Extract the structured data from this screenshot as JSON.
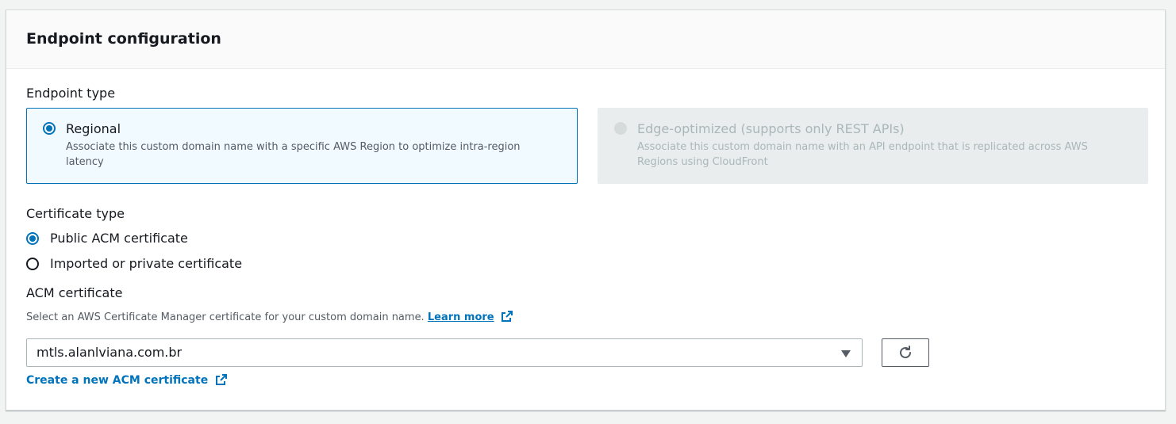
{
  "panel": {
    "title": "Endpoint configuration"
  },
  "endpoint_type": {
    "label": "Endpoint type",
    "options": [
      {
        "title": "Regional",
        "description": "Associate this custom domain name with a specific AWS Region to optimize intra-region latency",
        "selected": true,
        "disabled": false
      },
      {
        "title": "Edge-optimized (supports only REST APIs)",
        "description": "Associate this custom domain name with an API endpoint that is replicated across AWS Regions using CloudFront",
        "selected": false,
        "disabled": true
      }
    ]
  },
  "certificate_type": {
    "label": "Certificate type",
    "options": [
      {
        "label": "Public ACM certificate",
        "selected": true
      },
      {
        "label": "Imported or private certificate",
        "selected": false
      }
    ]
  },
  "acm_certificate": {
    "label": "ACM certificate",
    "description": "Select an AWS Certificate Manager certificate for your custom domain name.",
    "learn_more": "Learn more",
    "selected_value": "mtls.alanlviana.com.br",
    "create_link": "Create a new ACM certificate"
  },
  "icons": {
    "external_link": "external-link-icon",
    "refresh": "refresh-icon",
    "caret": "caret-down-icon"
  },
  "colors": {
    "accent": "#0073bb",
    "selected_tile_bg": "#f1faff",
    "disabled_tile_bg": "#eaeded",
    "text": "#16191f",
    "muted_text": "#545b64"
  }
}
